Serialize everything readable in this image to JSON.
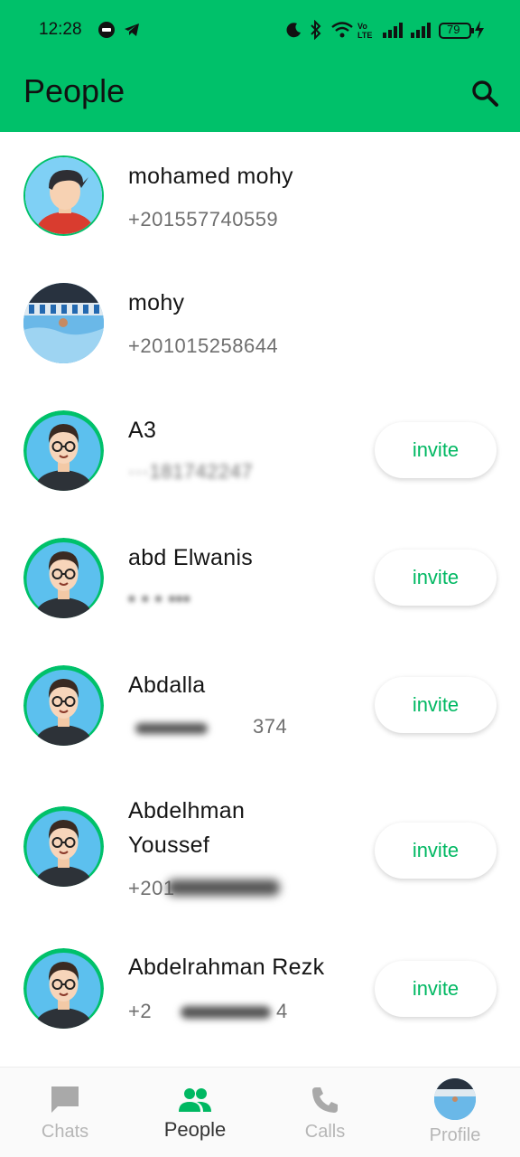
{
  "status_bar": {
    "time": "12:28",
    "battery": "79",
    "icons": [
      "app-notification-icon",
      "telegram-icon",
      "moon-icon",
      "bluetooth-icon",
      "wifi-icon",
      "volte-icon",
      "signal-icon",
      "signal-icon",
      "battery-icon",
      "charging-icon"
    ]
  },
  "header": {
    "title": "People",
    "search_icon": "search-icon"
  },
  "contacts": [
    {
      "name": "mohamed mohy",
      "phone": "+201557740559",
      "has_invite": false
    },
    {
      "name": "mohy",
      "phone": "+201015258644",
      "has_invite": false
    },
    {
      "name": "A3",
      "phone": "···181742247",
      "has_invite": true
    },
    {
      "name": "abd Elwanis",
      "phone": "• • • •••",
      "has_invite": true
    },
    {
      "name": "Abdalla",
      "phone": "374",
      "has_invite": true
    },
    {
      "name": "Abdelhman Youssef",
      "phone": "+201",
      "has_invite": true
    },
    {
      "name": "Abdelrahman Rezk",
      "phone": "+2",
      "phone_tail": "4",
      "has_invite": true
    }
  ],
  "invite_label": "invite",
  "bottom_nav": [
    {
      "label": "Chats",
      "icon": "chat-icon",
      "active": false
    },
    {
      "label": "People",
      "icon": "people-icon",
      "active": true
    },
    {
      "label": "Calls",
      "icon": "phone-icon",
      "active": false
    },
    {
      "label": "Profile",
      "icon": "profile-avatar",
      "active": false
    }
  ],
  "colors": {
    "accent": "#00c16a",
    "invite_text": "#00b862"
  }
}
